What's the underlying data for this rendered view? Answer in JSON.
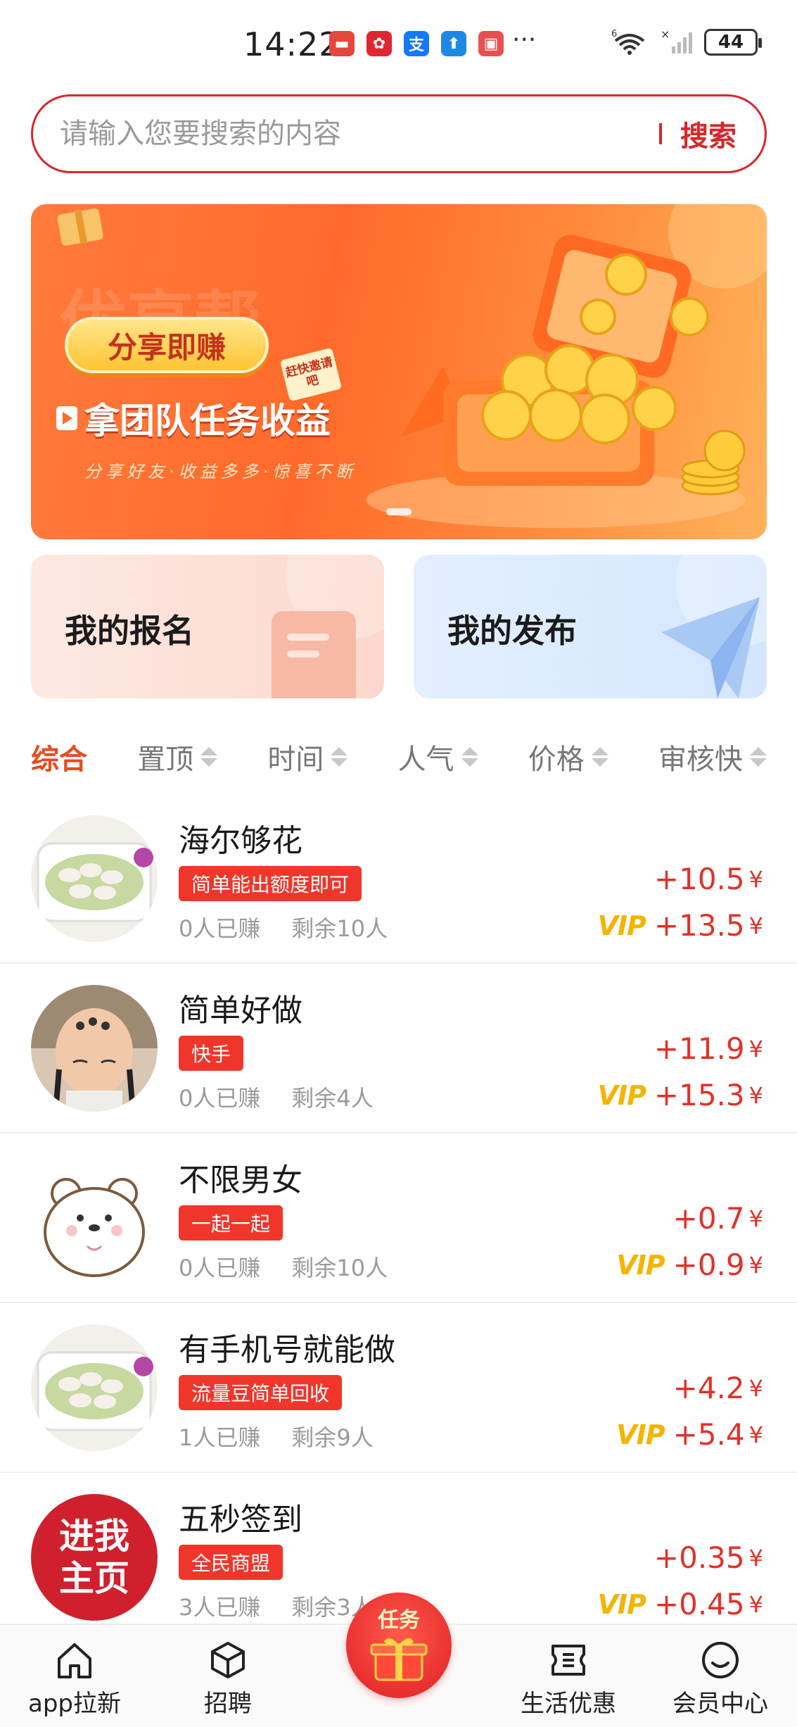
{
  "status_bar": {
    "time": "14:22",
    "battery": "44",
    "network": "6"
  },
  "search": {
    "placeholder": "请输入您要搜索的内容",
    "button_label": "搜索"
  },
  "banner": {
    "watermark": "优享帮",
    "pill": "分享即赚",
    "tag": "赶快邀请吧",
    "title": "拿团队任务收益",
    "subtitle": "分享好友·收益多多·惊喜不断"
  },
  "shortcuts": {
    "signup_label": "我的报名",
    "publish_label": "我的发布"
  },
  "filter_tabs": [
    {
      "label": "综合",
      "active": true
    },
    {
      "label": "置顶"
    },
    {
      "label": "时间"
    },
    {
      "label": "人气"
    },
    {
      "label": "价格"
    },
    {
      "label": "审核快"
    }
  ],
  "tasks": [
    {
      "title": "海尔够花",
      "tag": "简单能出额度即可",
      "earned": "0人已赚",
      "remaining": "剩余10人",
      "price": "+10.5",
      "vip_price": "+13.5",
      "currency": "¥",
      "avatar": "shrimp"
    },
    {
      "title": "简单好做",
      "tag": "快手",
      "earned": "0人已赚",
      "remaining": "剩余4人",
      "price": "+11.9",
      "vip_price": "+15.3",
      "currency": "¥",
      "avatar": "baby"
    },
    {
      "title": "不限男女",
      "tag": "一起一起",
      "earned": "0人已赚",
      "remaining": "剩余10人",
      "price": "+0.7",
      "vip_price": "+0.9",
      "currency": "¥",
      "avatar": "bear"
    },
    {
      "title": "有手机号就能做",
      "tag": "流量豆简单回收",
      "earned": "1人已赚",
      "remaining": "剩余9人",
      "price": "+4.2",
      "vip_price": "+5.4",
      "currency": "¥",
      "avatar": "shrimp"
    },
    {
      "title": "五秒签到",
      "tag": "全民商盟",
      "earned": "3人已赚",
      "remaining": "剩余3人",
      "price": "+0.35",
      "vip_price": "+0.45",
      "currency": "¥",
      "avatar": "homepage",
      "avatar_text": [
        "进我",
        "主页"
      ]
    }
  ],
  "vip_label": "VIP",
  "bottom_nav": {
    "items": [
      {
        "label": "app拉新",
        "icon": "home-icon"
      },
      {
        "label": "招聘",
        "icon": "box-icon"
      },
      {
        "label": "生活优惠",
        "icon": "ticket-icon"
      },
      {
        "label": "会员中心",
        "icon": "smile-icon"
      }
    ],
    "center_label": "任务"
  },
  "colors": {
    "primary": "#d8272a",
    "price": "#e3302a",
    "vip": "#f4b400",
    "tag": "#f0362a",
    "active_tab": "#e84a1f"
  }
}
